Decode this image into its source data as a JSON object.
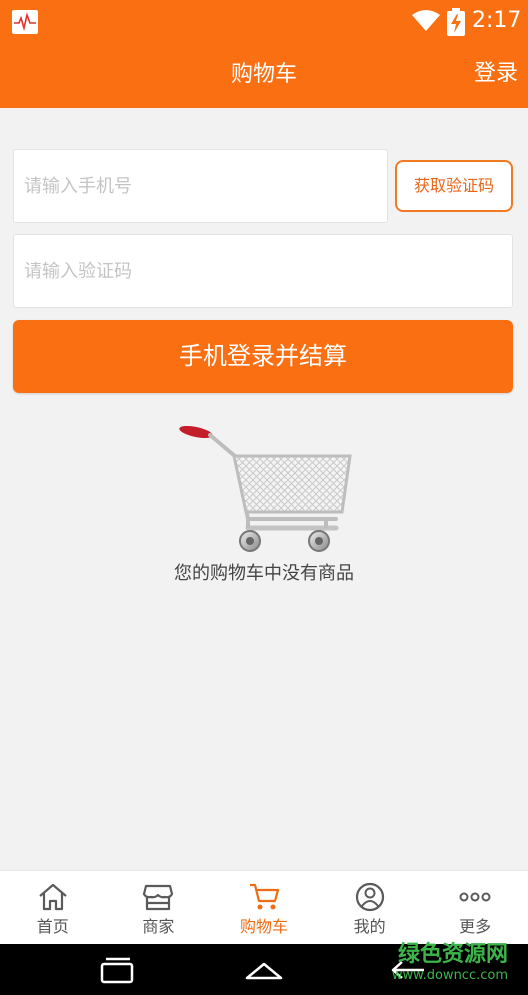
{
  "status_bar": {
    "time": "2:17"
  },
  "header": {
    "title": "购物车",
    "login_label": "登录"
  },
  "login_form": {
    "phone_placeholder": "请输入手机号",
    "phone_value": "",
    "code_placeholder": "请输入验证码",
    "code_value": "",
    "get_code_label": "获取验证码",
    "submit_label": "手机登录并结算"
  },
  "empty_cart": {
    "message": "您的购物车中没有商品"
  },
  "tabs": [
    {
      "label": "首页",
      "icon": "home-icon",
      "active": false
    },
    {
      "label": "商家",
      "icon": "store-icon",
      "active": false
    },
    {
      "label": "购物车",
      "icon": "cart-icon",
      "active": true
    },
    {
      "label": "我的",
      "icon": "user-icon",
      "active": false
    },
    {
      "label": "更多",
      "icon": "more-icon",
      "active": false
    }
  ],
  "watermark": {
    "main": "绿色资源网",
    "sub": "www.downcc.com"
  },
  "colors": {
    "accent": "#fa6f12",
    "tab_active": "#f06c12",
    "background": "#f2f2f2"
  }
}
